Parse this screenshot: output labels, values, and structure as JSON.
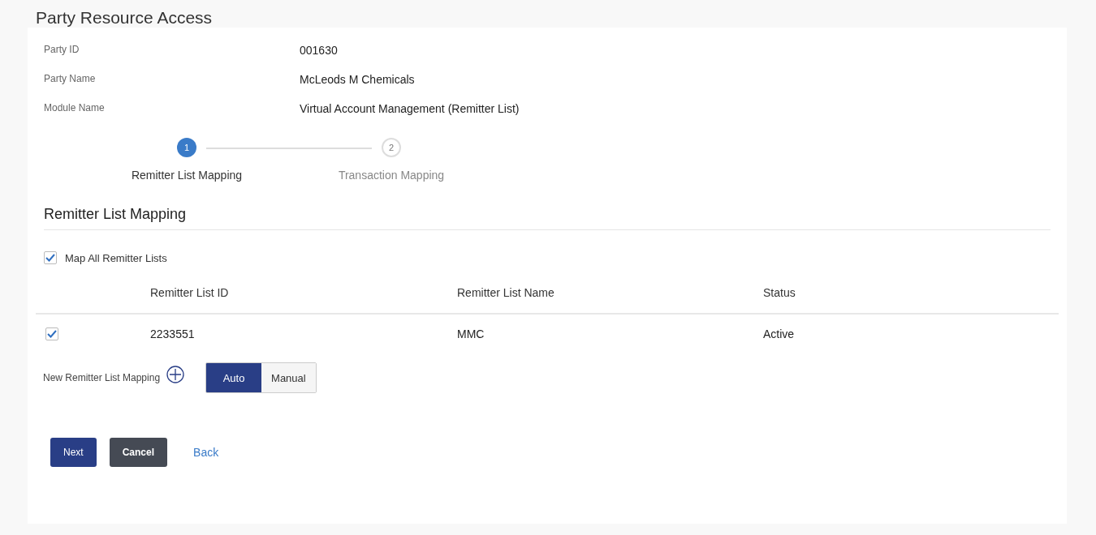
{
  "page_title": "Party Resource Access",
  "details": [
    {
      "label": "Party ID",
      "value": "001630"
    },
    {
      "label": "Party Name",
      "value": "McLeods M Chemicals"
    },
    {
      "label": "Module Name",
      "value": "Virtual Account Management (Remitter List)"
    }
  ],
  "steps": [
    {
      "number": "1",
      "label": "Remitter List Mapping",
      "selected": true
    },
    {
      "number": "2",
      "label": "Transaction Mapping",
      "selected": false
    }
  ],
  "section_title": "Remitter List Mapping",
  "map_all": {
    "label": "Map All Remitter Lists",
    "checked": true
  },
  "table": {
    "columns": [
      "Remitter List ID",
      "Remitter List Name",
      "Status"
    ],
    "rows": [
      {
        "checked": true,
        "cells": [
          "2233551",
          "MMC",
          "Active"
        ]
      }
    ]
  },
  "new_mapping": {
    "label": "New Remitter List Mapping",
    "options": [
      {
        "label": "Auto",
        "selected": true
      },
      {
        "label": "Manual",
        "selected": false
      }
    ]
  },
  "buttons": [
    {
      "kind": "primary",
      "label": "Next"
    },
    {
      "kind": "secondary",
      "label": "Cancel"
    },
    {
      "kind": "link",
      "label": "Back"
    }
  ]
}
